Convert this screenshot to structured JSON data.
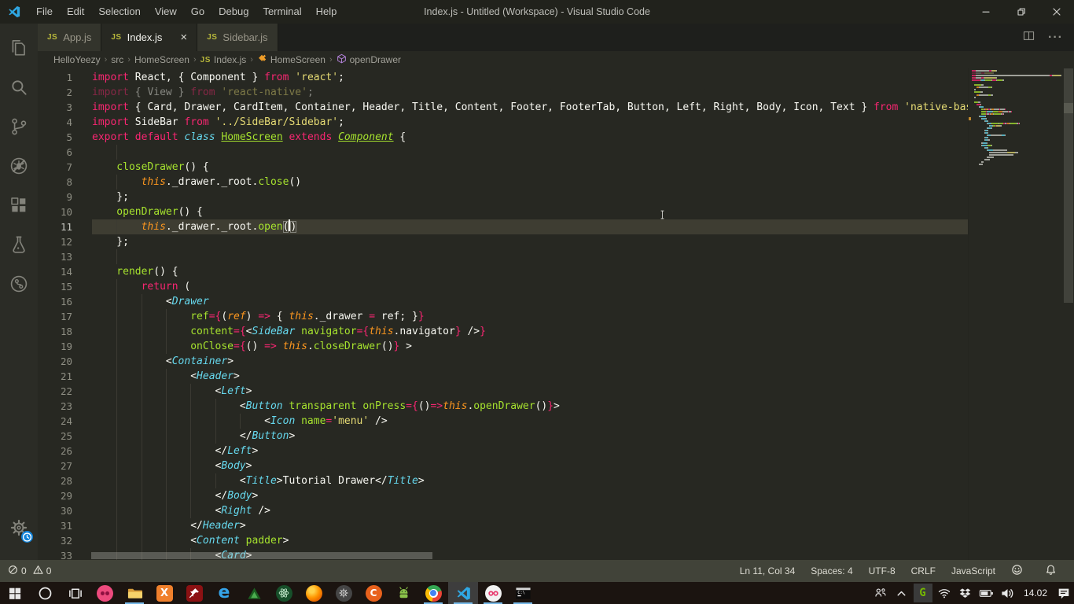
{
  "window": {
    "title": "Index.js - Untitled (Workspace) - Visual Studio Code",
    "menu": [
      "File",
      "Edit",
      "Selection",
      "View",
      "Go",
      "Debug",
      "Terminal",
      "Help"
    ],
    "controls": [
      {
        "name": "minimize"
      },
      {
        "name": "restore"
      },
      {
        "name": "close"
      }
    ]
  },
  "activity_bar": {
    "top": [
      {
        "name": "explorer"
      },
      {
        "name": "search"
      },
      {
        "name": "source-control"
      },
      {
        "name": "debug"
      },
      {
        "name": "extensions"
      },
      {
        "name": "test-beaker"
      },
      {
        "name": "git-graph"
      }
    ],
    "bottom": [
      {
        "name": "settings-gear",
        "badge": "update-clock"
      }
    ]
  },
  "tabs": [
    {
      "label": "App.js",
      "icon": "js",
      "active": false
    },
    {
      "label": "Index.js",
      "icon": "js",
      "active": true,
      "close": "×"
    },
    {
      "label": "Sidebar.js",
      "icon": "js",
      "active": false
    }
  ],
  "tab_actions": [
    {
      "name": "split-editor"
    },
    {
      "name": "more-actions",
      "glyph": "···"
    }
  ],
  "breadcrumb": [
    {
      "label": "HelloYeezy"
    },
    {
      "label": "src"
    },
    {
      "label": "HomeScreen"
    },
    {
      "label": "Index.js",
      "icon": "js"
    },
    {
      "label": "HomeScreen",
      "icon": "symbol-class"
    },
    {
      "label": "openDrawer",
      "icon": "symbol-method"
    }
  ],
  "editor": {
    "language": "JavaScript",
    "current_line": 11,
    "cursor": {
      "line": 11,
      "col": 34
    },
    "lines": [
      {
        "n": 1,
        "ind": 0,
        "t": [
          [
            "k",
            "import"
          ],
          [
            "w",
            " React, { Component } "
          ],
          [
            "k",
            "from"
          ],
          [
            "w",
            " "
          ],
          [
            "s",
            "'react'"
          ],
          [
            "w",
            ";"
          ]
        ]
      },
      {
        "n": 2,
        "ind": 0,
        "dim": true,
        "t": [
          [
            "k",
            "import"
          ],
          [
            "w",
            " { View } "
          ],
          [
            "k",
            "from"
          ],
          [
            "w",
            " "
          ],
          [
            "s",
            "'react-native'"
          ],
          [
            "w",
            ";"
          ]
        ]
      },
      {
        "n": 3,
        "ind": 0,
        "t": [
          [
            "k",
            "import"
          ],
          [
            "w",
            " { Card, Drawer, CardItem, Container, Header, Title, Content, Footer, FooterTab, Button, Left, Right, Body, Icon, Text } "
          ],
          [
            "k",
            "from"
          ],
          [
            "w",
            " "
          ],
          [
            "s",
            "'native-base'"
          ],
          [
            "w",
            ";"
          ]
        ]
      },
      {
        "n": 4,
        "ind": 0,
        "t": [
          [
            "k",
            "import"
          ],
          [
            "w",
            " SideBar "
          ],
          [
            "k",
            "from"
          ],
          [
            "w",
            " "
          ],
          [
            "s",
            "'../SideBar/Sidebar'"
          ],
          [
            "w",
            ";"
          ]
        ]
      },
      {
        "n": 5,
        "ind": 0,
        "t": [
          [
            "k",
            "export default"
          ],
          [
            "w",
            " "
          ],
          [
            "cyi",
            "class"
          ],
          [
            "w",
            " "
          ],
          [
            "clsU",
            "HomeScreen"
          ],
          [
            "w",
            " "
          ],
          [
            "k",
            "extends"
          ],
          [
            "w",
            " "
          ],
          [
            "clsUi",
            "Component"
          ],
          [
            "w",
            " {"
          ]
        ]
      },
      {
        "n": 6,
        "ind": 8,
        "t": []
      },
      {
        "n": 7,
        "ind": 4,
        "t": [
          [
            "fn",
            "closeDrawer"
          ],
          [
            "w",
            "() {"
          ]
        ]
      },
      {
        "n": 8,
        "ind": 8,
        "t": [
          [
            "or",
            "this"
          ],
          [
            "w",
            "._drawer._root."
          ],
          [
            "fn",
            "close"
          ],
          [
            "w",
            "()"
          ]
        ]
      },
      {
        "n": 9,
        "ind": 4,
        "t": [
          [
            "w",
            "};"
          ]
        ]
      },
      {
        "n": 10,
        "ind": 4,
        "t": [
          [
            "fn",
            "openDrawer"
          ],
          [
            "w",
            "() {"
          ]
        ]
      },
      {
        "n": 11,
        "ind": 8,
        "t": [
          [
            "or",
            "this"
          ],
          [
            "w",
            "._drawer._root."
          ],
          [
            "fn",
            "open"
          ],
          [
            "bm",
            "("
          ],
          [
            "cur",
            ""
          ],
          [
            "bm",
            ")"
          ]
        ]
      },
      {
        "n": 12,
        "ind": 4,
        "t": [
          [
            "w",
            "};"
          ]
        ]
      },
      {
        "n": 13,
        "ind": 8,
        "t": []
      },
      {
        "n": 14,
        "ind": 4,
        "t": [
          [
            "fn",
            "render"
          ],
          [
            "w",
            "() {"
          ]
        ]
      },
      {
        "n": 15,
        "ind": 8,
        "t": [
          [
            "k",
            "return"
          ],
          [
            "w",
            " ("
          ]
        ]
      },
      {
        "n": 16,
        "ind": 12,
        "t": [
          [
            "w",
            "<"
          ],
          [
            "cyi",
            "Drawer"
          ]
        ]
      },
      {
        "n": 17,
        "ind": 16,
        "t": [
          [
            "fn",
            "ref"
          ],
          [
            "k",
            "={"
          ],
          [
            "w",
            "("
          ],
          [
            "or",
            "ref"
          ],
          [
            "w",
            ") "
          ],
          [
            "k",
            "=>"
          ],
          [
            "w",
            " { "
          ],
          [
            "or",
            "this"
          ],
          [
            "w",
            "._drawer "
          ],
          [
            "k",
            "="
          ],
          [
            "w",
            " ref; }"
          ],
          [
            "k",
            "}"
          ]
        ]
      },
      {
        "n": 18,
        "ind": 16,
        "t": [
          [
            "fn",
            "content"
          ],
          [
            "k",
            "={"
          ],
          [
            "w",
            "<"
          ],
          [
            "cyi",
            "SideBar"
          ],
          [
            "w",
            " "
          ],
          [
            "fn",
            "navigator"
          ],
          [
            "k",
            "={"
          ],
          [
            "or",
            "this"
          ],
          [
            "w",
            ".navigator"
          ],
          [
            "k",
            "}"
          ],
          [
            "w",
            " />"
          ],
          [
            "k",
            "}"
          ]
        ]
      },
      {
        "n": 19,
        "ind": 16,
        "t": [
          [
            "fn",
            "onClose"
          ],
          [
            "k",
            "={"
          ],
          [
            "w",
            "() "
          ],
          [
            "k",
            "=>"
          ],
          [
            "w",
            " "
          ],
          [
            "or",
            "this"
          ],
          [
            "w",
            "."
          ],
          [
            "fn",
            "closeDrawer"
          ],
          [
            "w",
            "()"
          ],
          [
            "k",
            "}"
          ],
          [
            "w",
            " >"
          ]
        ]
      },
      {
        "n": 20,
        "ind": 12,
        "t": [
          [
            "w",
            "<"
          ],
          [
            "cyi",
            "Container"
          ],
          [
            "w",
            ">"
          ]
        ]
      },
      {
        "n": 21,
        "ind": 16,
        "t": [
          [
            "w",
            "<"
          ],
          [
            "cyi",
            "Header"
          ],
          [
            "w",
            ">"
          ]
        ]
      },
      {
        "n": 22,
        "ind": 20,
        "t": [
          [
            "w",
            "<"
          ],
          [
            "cyi",
            "Left"
          ],
          [
            "w",
            ">"
          ]
        ]
      },
      {
        "n": 23,
        "ind": 24,
        "t": [
          [
            "w",
            "<"
          ],
          [
            "cyi",
            "Button"
          ],
          [
            "w",
            " "
          ],
          [
            "fn",
            "transparent"
          ],
          [
            "w",
            " "
          ],
          [
            "fn",
            "onPress"
          ],
          [
            "k",
            "={"
          ],
          [
            "w",
            "()"
          ],
          [
            "k",
            "=>"
          ],
          [
            "or",
            "this"
          ],
          [
            "w",
            "."
          ],
          [
            "fn",
            "openDrawer"
          ],
          [
            "w",
            "()"
          ],
          [
            "k",
            "}"
          ],
          [
            "w",
            ">"
          ]
        ]
      },
      {
        "n": 24,
        "ind": 28,
        "t": [
          [
            "w",
            "<"
          ],
          [
            "cyi",
            "Icon"
          ],
          [
            "w",
            " "
          ],
          [
            "fn",
            "name"
          ],
          [
            "k",
            "="
          ],
          [
            "s",
            "'menu'"
          ],
          [
            "w",
            " />"
          ]
        ]
      },
      {
        "n": 25,
        "ind": 24,
        "t": [
          [
            "w",
            "</"
          ],
          [
            "cyi",
            "Button"
          ],
          [
            "w",
            ">"
          ]
        ]
      },
      {
        "n": 26,
        "ind": 20,
        "t": [
          [
            "w",
            "</"
          ],
          [
            "cyi",
            "Left"
          ],
          [
            "w",
            ">"
          ]
        ]
      },
      {
        "n": 27,
        "ind": 20,
        "t": [
          [
            "w",
            "<"
          ],
          [
            "cyi",
            "Body"
          ],
          [
            "w",
            ">"
          ]
        ]
      },
      {
        "n": 28,
        "ind": 24,
        "t": [
          [
            "w",
            "<"
          ],
          [
            "cyi",
            "Title"
          ],
          [
            "w",
            ">"
          ],
          [
            "w",
            "Tutorial Drawer"
          ],
          [
            "w",
            "</"
          ],
          [
            "cyi",
            "Title"
          ],
          [
            "w",
            ">"
          ]
        ]
      },
      {
        "n": 29,
        "ind": 20,
        "t": [
          [
            "w",
            "</"
          ],
          [
            "cyi",
            "Body"
          ],
          [
            "w",
            ">"
          ]
        ]
      },
      {
        "n": 30,
        "ind": 20,
        "t": [
          [
            "w",
            "<"
          ],
          [
            "cyi",
            "Right"
          ],
          [
            "w",
            " />"
          ]
        ]
      },
      {
        "n": 31,
        "ind": 16,
        "t": [
          [
            "w",
            "</"
          ],
          [
            "cyi",
            "Header"
          ],
          [
            "w",
            ">"
          ]
        ]
      },
      {
        "n": 32,
        "ind": 16,
        "t": [
          [
            "w",
            "<"
          ],
          [
            "cyi",
            "Content"
          ],
          [
            "w",
            " "
          ],
          [
            "fn",
            "padder"
          ],
          [
            "w",
            ">"
          ]
        ]
      },
      {
        "n": 33,
        "ind": 20,
        "t": [
          [
            "w",
            "<"
          ],
          [
            "cyi",
            "Card"
          ],
          [
            "w",
            ">"
          ]
        ]
      }
    ],
    "minimap_extra": [
      [
        24,
        [
          [
            "w",
            2
          ],
          [
            "cyi",
            8
          ],
          [
            "w",
            24
          ]
        ]
      ],
      [
        28,
        [
          [
            "w",
            30
          ],
          [
            "s",
            12
          ],
          [
            "w",
            6
          ]
        ]
      ],
      [
        28,
        [
          [
            "w",
            40
          ]
        ]
      ],
      [
        24,
        [
          [
            "w",
            12
          ]
        ]
      ],
      [
        20,
        [
          [
            "w",
            10
          ]
        ]
      ],
      [
        16,
        [
          [
            "w",
            3
          ]
        ]
      ],
      [
        12,
        [
          [
            "w",
            6
          ]
        ]
      ]
    ]
  },
  "status_bar": {
    "problems": [
      {
        "icon": "error-circle",
        "count": "0"
      },
      {
        "icon": "warning-triangle",
        "count": "0"
      }
    ],
    "right": [
      "Ln 11, Col 34",
      "Spaces: 4",
      "UTF-8",
      "CRLF",
      "JavaScript"
    ],
    "right_icons": [
      "feedback-smiley",
      "notifications-bell"
    ]
  },
  "taskbar": {
    "apps": [
      {
        "name": "start"
      },
      {
        "name": "cortana"
      },
      {
        "name": "task-view"
      },
      {
        "name": "pink-dots-app"
      },
      {
        "name": "file-explorer",
        "running": true
      },
      {
        "name": "xampp"
      },
      {
        "name": "red-pin-app"
      },
      {
        "name": "edge"
      },
      {
        "name": "green-triangle-app"
      },
      {
        "name": "green-atom-app"
      },
      {
        "name": "firefox"
      },
      {
        "name": "gray-gear-app"
      },
      {
        "name": "orange-c-app"
      },
      {
        "name": "android"
      },
      {
        "name": "chrome",
        "running": true
      },
      {
        "name": "vscode",
        "running": true,
        "focused": true
      },
      {
        "name": "white-dots-app",
        "running": true
      },
      {
        "name": "cmd",
        "running": true
      }
    ],
    "tray": [
      {
        "name": "people"
      },
      {
        "name": "chevron-up"
      },
      {
        "name": "green-utility"
      },
      {
        "name": "wifi"
      },
      {
        "name": "dropbox"
      },
      {
        "name": "battery"
      },
      {
        "name": "volume"
      }
    ],
    "clock": "14.02",
    "after_clock": [
      {
        "name": "action-center"
      }
    ]
  },
  "colors": {
    "editor_bg": "#272822",
    "keyword_pink": "#f92672",
    "string_yellow": "#e6db74",
    "function_green": "#a6e22e",
    "type_cyan": "#66d9ef",
    "param_orange": "#fd971f",
    "status_bg": "#414339",
    "accent_blue": "#1283d8",
    "taskbar_underline": "#76b9e8",
    "current_line": "#3e3d32"
  }
}
